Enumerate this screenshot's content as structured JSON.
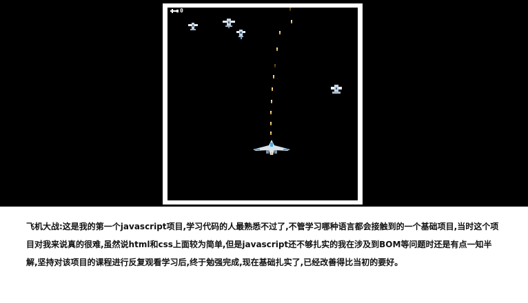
{
  "game": {
    "hud_score": "0",
    "hud_icon": "plane-lives-icon"
  },
  "caption": {
    "text": "飞机大战:这是我的第一个javascript项目,学习代码的人最熟悉不过了,不管学习哪种语言都会接触到的一个基础项目,当时这个项目对我来说真的很难,虽然说html和css上面较为简单,但是javascript还不够扎实的我在涉及到BOM等问题时还是有点一知半解,坚持对该项目的课程进行反复观看学习后,终于勉强完成,现在基础扎实了,已经改善得比当初的要好。"
  },
  "colors": {
    "stage_background": "#000000",
    "frame_border": "#ffffff",
    "bullet": "#e8c65a",
    "player_accent": "#4aa8e0"
  }
}
